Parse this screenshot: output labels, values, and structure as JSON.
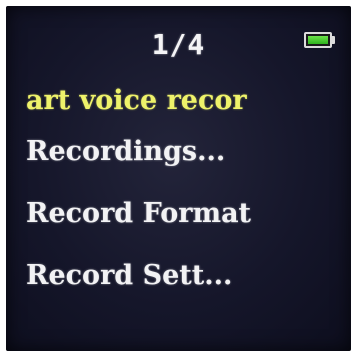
{
  "header": {
    "page_indicator": "1/4",
    "battery": {
      "icon": "battery-icon",
      "level": 1.0,
      "fill_color": "#4ccc33"
    }
  },
  "menu": {
    "items": [
      {
        "label": "art voice recor",
        "selected": true
      },
      {
        "label": "Recordings...",
        "selected": false
      },
      {
        "label": "Record Format",
        "selected": false
      },
      {
        "label": "Record Sett...",
        "selected": false
      }
    ],
    "selected_color": "#eef26a",
    "text_color": "#f2f2f4"
  }
}
